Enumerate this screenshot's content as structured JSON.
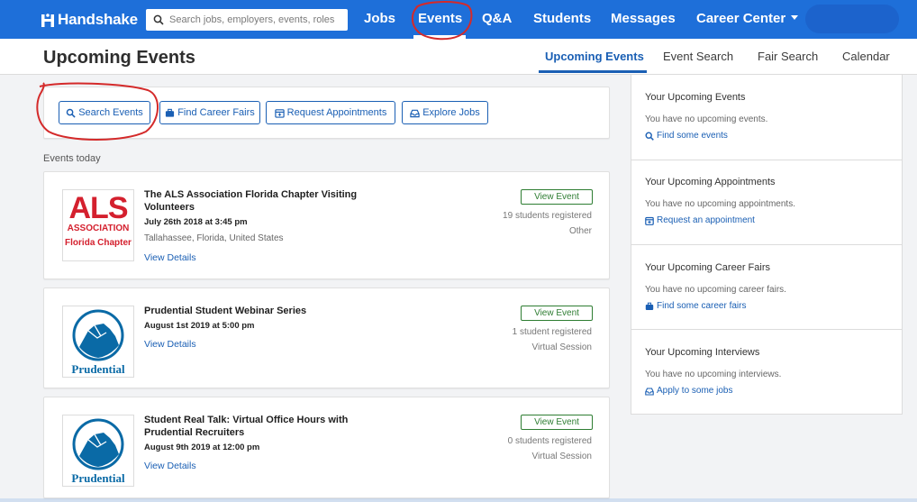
{
  "brand": {
    "name": "Handshake"
  },
  "search": {
    "placeholder": "Search jobs, employers, events, roles"
  },
  "nav": {
    "jobs": "Jobs",
    "events": "Events",
    "qa": "Q&A",
    "students": "Students",
    "messages": "Messages",
    "career_center": "Career Center"
  },
  "page": {
    "title": "Upcoming Events",
    "tabs": [
      "Upcoming Events",
      "Event Search",
      "Fair Search",
      "Calendar"
    ]
  },
  "actions": {
    "search_events": "Search Events",
    "find_career_fairs": "Find Career Fairs",
    "request_appointments": "Request Appointments",
    "explore_jobs": "Explore Jobs"
  },
  "events_today_label": "Events today",
  "events": [
    {
      "title": "The ALS Association Florida Chapter Visiting Volunteers",
      "date": "July 26th 2018 at 3:45 pm",
      "location": "Tallahassee, Florida, United States",
      "details": "View Details",
      "button": "View Event",
      "registered": "19 students registered",
      "type": "Other",
      "logo": {
        "line1": "ALS",
        "line2": "ASSOCIATION",
        "line3": "Florida Chapter"
      }
    },
    {
      "title": "Prudential Student Webinar Series",
      "date": "August 1st 2019 at 5:00 pm",
      "details": "View Details",
      "button": "View Event",
      "registered": "1 student registered",
      "type": "Virtual Session",
      "logo": {
        "name": "Prudential"
      }
    },
    {
      "title": "Student Real Talk: Virtual Office Hours with Prudential Recruiters",
      "date": "August 9th 2019 at 12:00 pm",
      "details": "View Details",
      "button": "View Event",
      "registered": "0 students registered",
      "type": "Virtual Session",
      "logo": {
        "name": "Prudential"
      }
    }
  ],
  "sidebar": {
    "events": {
      "title": "Your Upcoming Events",
      "empty": "You have no upcoming events.",
      "link": "Find some events"
    },
    "appointments": {
      "title": "Your Upcoming Appointments",
      "empty": "You have no upcoming appointments.",
      "link": "Request an appointment"
    },
    "fairs": {
      "title": "Your Upcoming Career Fairs",
      "empty": "You have no upcoming career fairs.",
      "link": "Find some career fairs"
    },
    "interviews": {
      "title": "Your Upcoming Interviews",
      "empty": "You have no upcoming interviews.",
      "link": "Apply to some jobs"
    }
  },
  "colors": {
    "nav_blue": "#1e6fd9",
    "link_blue": "#1a5fb4",
    "view_event_green": "#2e7d32",
    "als_red": "#d4202e",
    "prudential_blue": "#0a6aa6",
    "annotation_red": "#d42a2a"
  }
}
